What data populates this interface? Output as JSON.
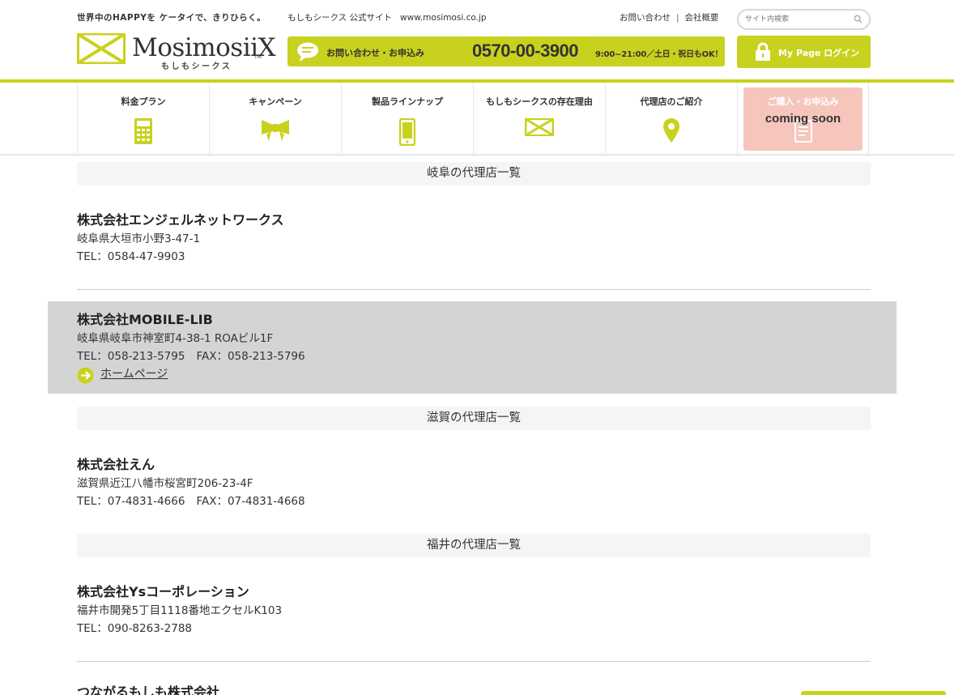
{
  "header": {
    "tagline": "世界中のHAPPYを ケータイで、きりひらく。",
    "site_name": "もしもシークス 公式サイト",
    "site_url": "www.mosimosi.co.jp",
    "links": [
      "お問い合わせ",
      "会社概要"
    ],
    "search_placeholder": "サイト内検索",
    "logo_text": "MosimosiiX",
    "logo_tm": "TM",
    "logo_kana": "もしもシークス",
    "contact_label": "お問い合わせ・お申込み",
    "phone": "0570-00-3900",
    "hours": "9:00~21:00／土日・祝日もOK！",
    "mypage_label": "My Page ログイン",
    "accent_color": "#c8d21e"
  },
  "nav": {
    "items": [
      {
        "label": "料金プラン",
        "icon": "calculator-icon"
      },
      {
        "label": "キャンペーン",
        "icon": "ribbon-icon"
      },
      {
        "label": "製品ラインナップ",
        "icon": "smartphone-icon"
      },
      {
        "label": "もしもシークスの存在理由",
        "icon": "bowtie-icon"
      },
      {
        "label": "代理店のご紹介",
        "icon": "map-pin-icon"
      }
    ],
    "apply": {
      "label": "ご購入・お申込み",
      "status": "coming soon",
      "icon": "document-icon"
    }
  },
  "sections": [
    {
      "region": "岐阜の代理店一覧",
      "dealers": [
        {
          "name": "株式会社エンジェルネットワークス",
          "address": "岐阜県大垣市小野3-47-1",
          "tel": "TEL：0584-47-9903"
        },
        {
          "name": "株式会社MOBILE-LIB",
          "address": "岐阜県岐阜市神室町4-38-1 ROAビル1F",
          "tel": "TEL：058-213-5795",
          "fax": "FAX：058-213-5796",
          "homepage": "ホームページ"
        }
      ]
    },
    {
      "region": "滋賀の代理店一覧",
      "dealers": [
        {
          "name": "株式会社えん",
          "address": "滋賀県近江八幡市桜宮町206-23-4F",
          "tel": "TEL：07-4831-4666",
          "fax": "FAX：07-4831-4668"
        }
      ]
    },
    {
      "region": "福井の代理店一覧",
      "dealers": [
        {
          "name": "株式会社Ysコーポレーション",
          "address": "福井市開発5丁目1118番地エクセルK103",
          "tel": "TEL：090-8263-2788"
        },
        {
          "name": "つながるもしも株式会社"
        }
      ]
    }
  ]
}
